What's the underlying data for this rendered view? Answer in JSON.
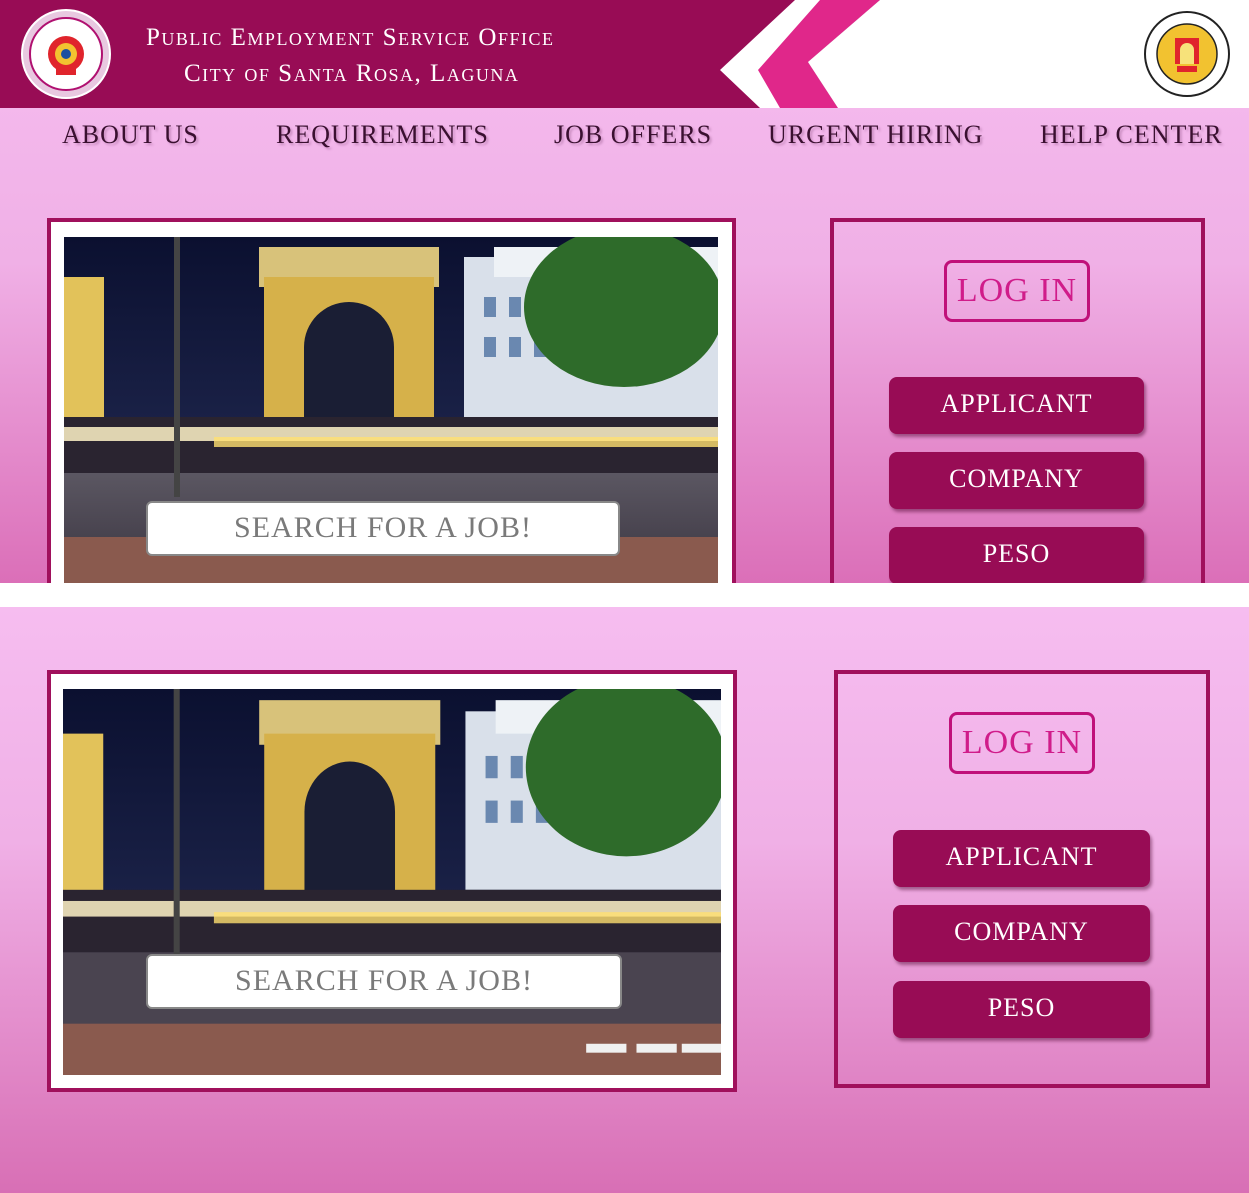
{
  "header": {
    "title_line1": "Public Employment Service Office",
    "title_line2": "City of Santa Rosa, Laguna",
    "logo_icon": "peso-seal-logo",
    "seal_icon": "city-seal-logo",
    "band_color": "#980c55",
    "accent_color": "#e0278a"
  },
  "nav": {
    "items": [
      {
        "label": "ABOUT US"
      },
      {
        "label": "REQUIREMENTS"
      },
      {
        "label": "JOB OFFERS"
      },
      {
        "label": "URGENT HIRING"
      },
      {
        "label": "HELP CENTER"
      }
    ]
  },
  "panels": [
    {
      "search_label": "SEARCH FOR A JOB!",
      "login_title": "LOG IN",
      "buttons": [
        {
          "label": "APPLICANT"
        },
        {
          "label": "COMPANY"
        },
        {
          "label": "PESO"
        }
      ]
    },
    {
      "search_label": "SEARCH FOR A JOB!",
      "login_title": "LOG IN",
      "buttons": [
        {
          "label": "APPLICANT"
        },
        {
          "label": "COMPANY"
        },
        {
          "label": "PESO"
        }
      ]
    }
  ],
  "colors": {
    "brand": "#980c55",
    "frame": "#a0105c",
    "login_text": "#d01c8a",
    "bg_top": "#f6bdf0",
    "bg_bottom": "#d86fb5"
  }
}
